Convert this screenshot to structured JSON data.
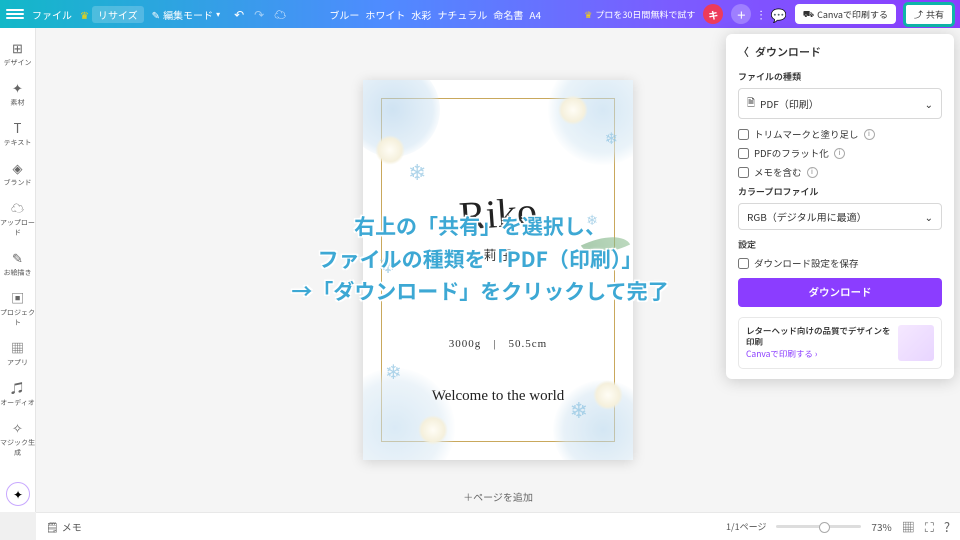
{
  "topbar": {
    "file": "ファイル",
    "resize": "リサイズ",
    "edit_mode": "編集モード",
    "title_tags": [
      "ブルー",
      "ホワイト",
      "水彩",
      "ナチュラル",
      "命名書",
      "A4"
    ],
    "pro": "プロを30日間無料で試す",
    "logo_letter": "キ",
    "print": "Canvaで印刷する",
    "share": "共有"
  },
  "sidebar": {
    "items": [
      {
        "icon": "⊞",
        "label": "デザイン"
      },
      {
        "icon": "✦",
        "label": "素材"
      },
      {
        "icon": "T",
        "label": "テキスト"
      },
      {
        "icon": "◈",
        "label": "ブランド"
      },
      {
        "icon": "☁",
        "label": "アップロード"
      },
      {
        "icon": "✎",
        "label": "お絵描き"
      },
      {
        "icon": "▣",
        "label": "プロジェクト"
      },
      {
        "icon": "▦",
        "label": "アプリ"
      },
      {
        "icon": "♫",
        "label": "オーディオ"
      },
      {
        "icon": "✧",
        "label": "マジック生成"
      }
    ]
  },
  "canvas": {
    "name_script": "Riko",
    "name_kanji": "莉 子",
    "stats": "3000g　|　50.5cm",
    "welcome": "Welcome to the world",
    "add_page": "＋ページを追加"
  },
  "panel": {
    "title": "ダウンロード",
    "file_type_label": "ファイルの種類",
    "file_type_value": "PDF（印刷）",
    "chk1": "トリムマークと塗り足し",
    "chk2": "PDFのフラット化",
    "chk3": "メモを含む",
    "color_label": "カラープロファイル",
    "color_value": "RGB（デジタル用に最適）",
    "settings_label": "設定",
    "chk4": "ダウンロード設定を保存",
    "download_btn": "ダウンロード",
    "promo_title": "レターヘッド向けの品質でデザインを印刷",
    "promo_link": "Canvaで印刷する"
  },
  "bottombar": {
    "notes": "メモ",
    "pager": "1/1ページ",
    "zoom": "73%"
  },
  "overlay": {
    "l1": "右上の「共有」を選択し、",
    "l2": "ファイルの種類を「PDF（印刷）」",
    "l3": "→「ダウンロード」をクリックして完了"
  }
}
